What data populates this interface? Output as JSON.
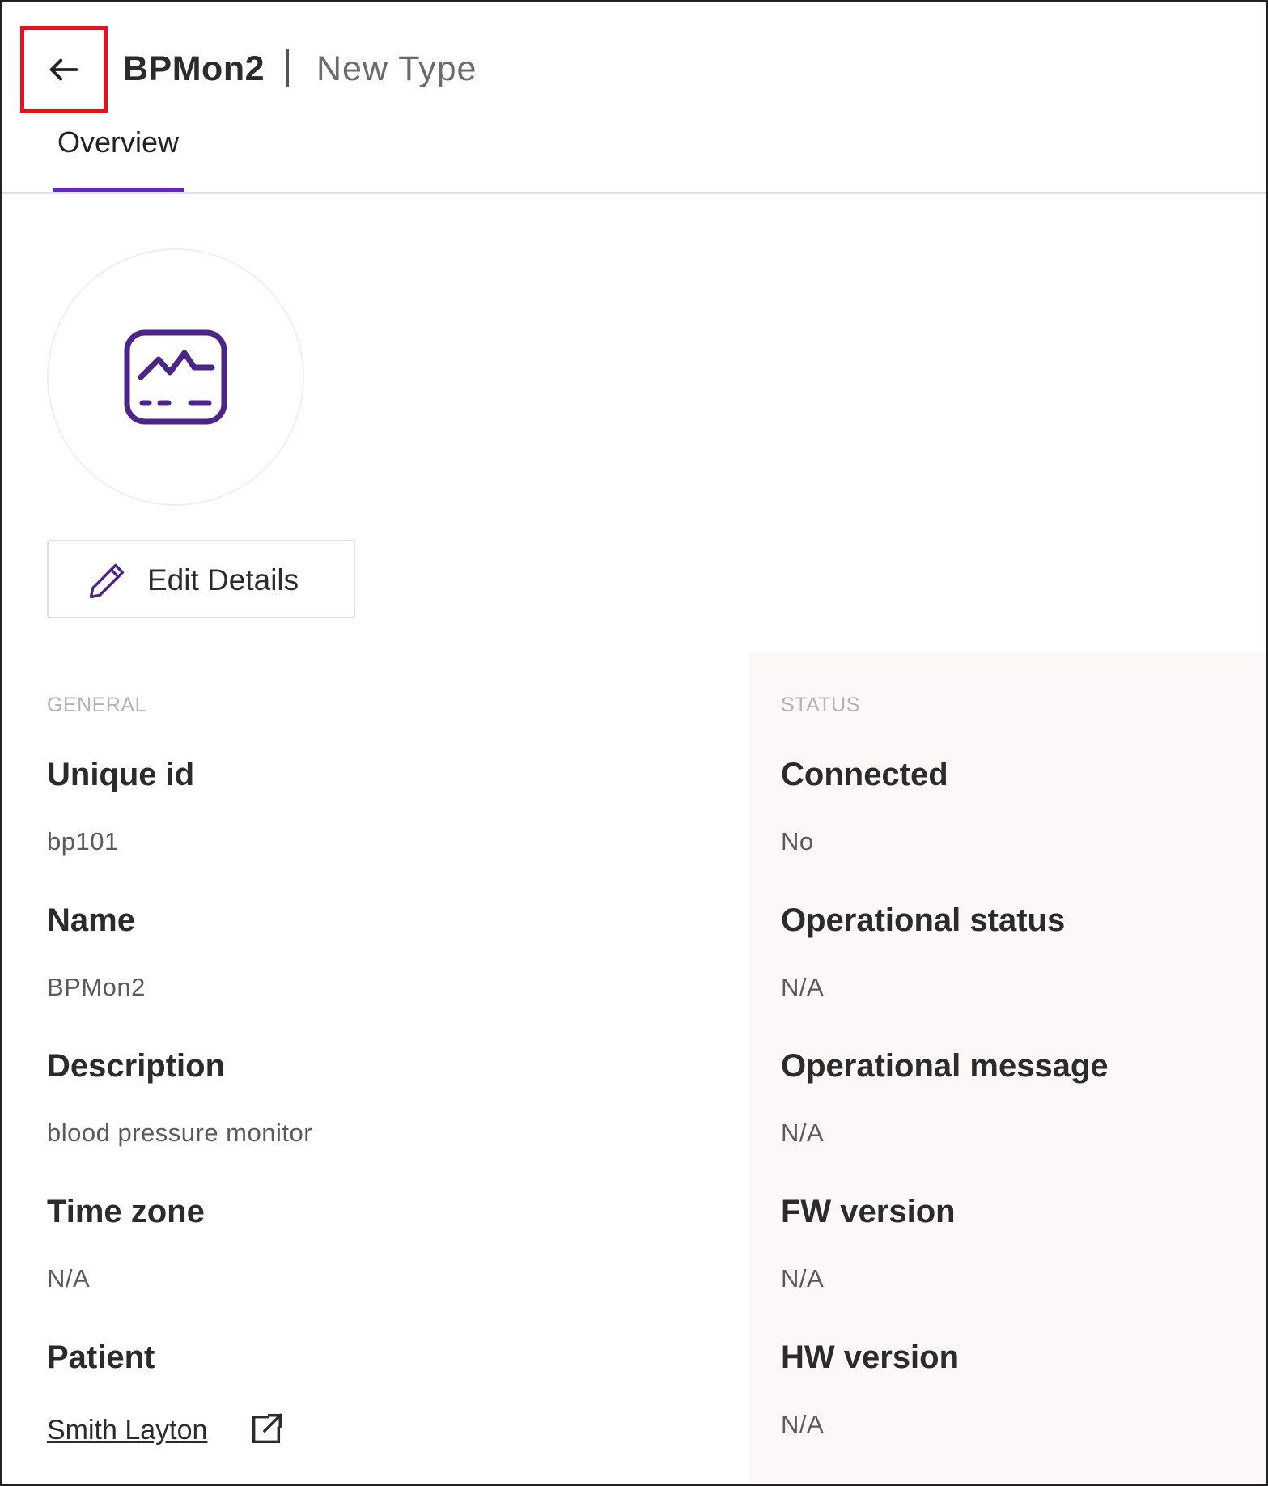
{
  "header": {
    "back_icon": "arrow-left-icon",
    "title": "BPMon2",
    "subtitle": "New Type"
  },
  "tabs": [
    {
      "label": "Overview",
      "active": true
    }
  ],
  "device_icon": "monitor-waveform-icon",
  "edit_button": {
    "label": "Edit Details",
    "icon": "pencil-icon"
  },
  "general": {
    "section_title": "GENERAL",
    "fields": [
      {
        "label": "Unique id",
        "value": "bp101"
      },
      {
        "label": "Name",
        "value": "BPMon2"
      },
      {
        "label": "Description",
        "value": "blood pressure monitor"
      },
      {
        "label": "Time zone",
        "value": "N/A"
      },
      {
        "label": "Patient",
        "value": "Smith Layton",
        "link_icon": "external-link-icon"
      }
    ]
  },
  "status": {
    "section_title": "STATUS",
    "fields": [
      {
        "label": "Connected",
        "value": "No"
      },
      {
        "label": "Operational status",
        "value": "N/A"
      },
      {
        "label": "Operational message",
        "value": "N/A"
      },
      {
        "label": "FW version",
        "value": "N/A"
      },
      {
        "label": "HW version",
        "value": "N/A"
      }
    ]
  },
  "colors": {
    "accent": "#6a22d1",
    "icon_purple": "#4b2587",
    "highlight_box": "#e8101c",
    "status_panel_bg": "#fcf8f7"
  }
}
